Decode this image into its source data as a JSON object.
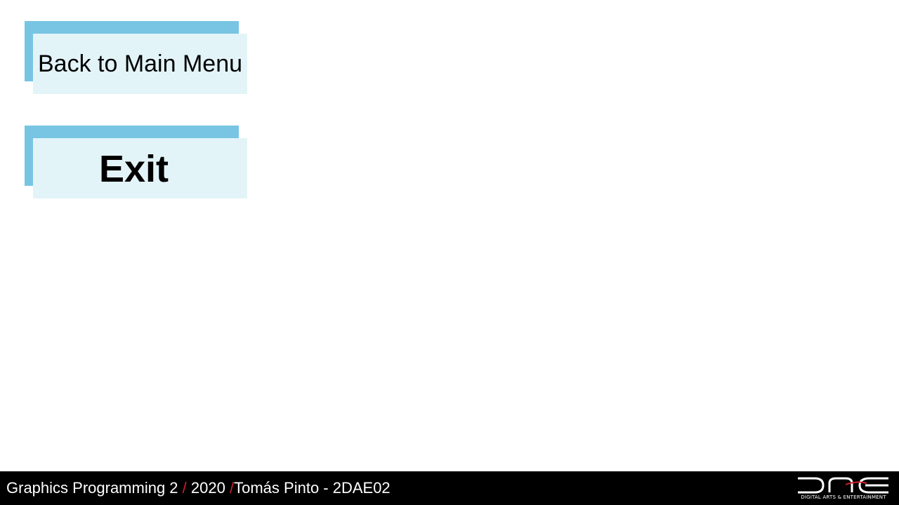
{
  "menu": {
    "back_label": "Back to Main Menu",
    "exit_label": "Exit"
  },
  "footer": {
    "course": "Graphics Programming 2",
    "separator": "/",
    "year": "2020",
    "author": "Tomás Pinto - 2DAE02",
    "logo_caption": "DIGITAL ARTS & ENTERTAINMENT",
    "logo_name": "dae-logo-icon"
  },
  "colors": {
    "button_shadow": "#77c5e3",
    "button_face": "#e3f4f8",
    "footer_bg": "#000000",
    "separator_accent": "#d0202a"
  }
}
